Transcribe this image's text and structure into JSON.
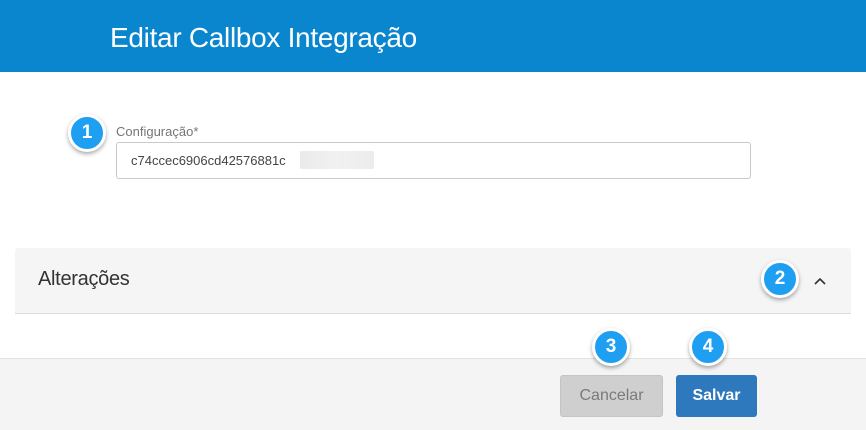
{
  "header": {
    "title": "Editar Callbox Integração",
    "bg_color": "#0a86ce"
  },
  "form": {
    "config_label": "Configuração*",
    "config_value": "c74ccec6906cd42576881c"
  },
  "section": {
    "title": "Alterações",
    "toggle_icon": "chevron-up-icon",
    "expanded": true
  },
  "footer": {
    "cancel_label": "Cancelar",
    "save_label": "Salvar",
    "save_color": "#2e78bd"
  },
  "markers": [
    "1",
    "2",
    "3",
    "4"
  ],
  "marker_color": "#1e9ff2"
}
